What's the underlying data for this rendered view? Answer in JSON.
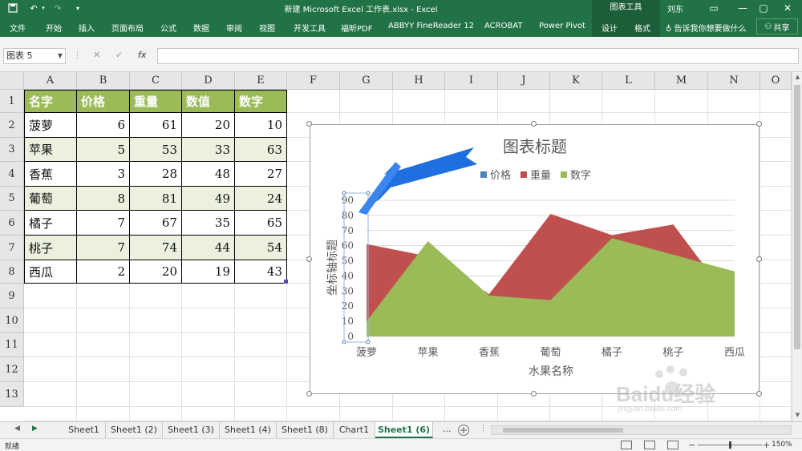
{
  "titlebar": {
    "undo_icon": "undo-icon",
    "redo_icon": "redo-icon",
    "document_title": "新建 Microsoft Excel 工作表.xlsx - Excel",
    "context_tools_label": "图表工具",
    "user_name": "刘东"
  },
  "ribbon": {
    "tabs": [
      "文件",
      "开始",
      "插入",
      "页面布局",
      "公式",
      "数据",
      "审阅",
      "视图",
      "开发工具",
      "福昕PDF",
      "ABBYY FineReader 12",
      "ACROBAT",
      "Power Pivot",
      "设计",
      "格式"
    ],
    "tell_me": "告诉我你想要做什么",
    "share_label": "共享"
  },
  "formula_bar": {
    "name_box": "图表 5",
    "fx_label": "fx",
    "formula_value": ""
  },
  "sheet": {
    "columns": [
      "A",
      "B",
      "C",
      "D",
      "E",
      "F",
      "G",
      "H",
      "I",
      "J",
      "K",
      "L",
      "M",
      "N",
      "O"
    ],
    "rows": [
      "1",
      "2",
      "3",
      "4",
      "5",
      "6",
      "7",
      "8",
      "9",
      "10",
      "11",
      "12",
      "13"
    ],
    "table": {
      "headers": [
        "名字",
        "价格",
        "重量",
        "数值",
        "数字"
      ],
      "rows": [
        [
          "菠萝",
          "6",
          "61",
          "20",
          "10"
        ],
        [
          "苹果",
          "5",
          "53",
          "33",
          "63"
        ],
        [
          "香蕉",
          "3",
          "28",
          "48",
          "27"
        ],
        [
          "葡萄",
          "8",
          "81",
          "49",
          "24"
        ],
        [
          "橘子",
          "7",
          "67",
          "35",
          "65"
        ],
        [
          "桃子",
          "7",
          "74",
          "44",
          "54"
        ],
        [
          "西瓜",
          "2",
          "20",
          "19",
          "43"
        ]
      ]
    }
  },
  "chart_data": {
    "type": "area",
    "title": "图表标题",
    "xlabel": "水果名称",
    "ylabel": "坐标轴标题",
    "categories": [
      "菠萝",
      "苹果",
      "香蕉",
      "葡萄",
      "橘子",
      "桃子",
      "西瓜"
    ],
    "series": [
      {
        "name": "价格",
        "values": [
          6,
          5,
          3,
          8,
          7,
          7,
          2
        ],
        "color": "#4f81bd"
      },
      {
        "name": "重量",
        "values": [
          61,
          53,
          28,
          81,
          67,
          74,
          20
        ],
        "color": "#c0504d"
      },
      {
        "name": "数字",
        "values": [
          10,
          63,
          27,
          24,
          65,
          54,
          43
        ],
        "color": "#9bbb59"
      }
    ],
    "ylim": [
      0,
      90
    ],
    "yticks": [
      "0",
      "10",
      "20",
      "30",
      "40",
      "50",
      "60",
      "70",
      "80",
      "90"
    ],
    "grid": true,
    "legend": "top"
  },
  "sheet_tabs": {
    "tabs": [
      "Sheet1",
      "Sheet1 (2)",
      "Sheet1 (3)",
      "Sheet1 (4)",
      "Sheet1 (8)",
      "Chart1",
      "Sheet1 (6)"
    ],
    "active": "Sheet1 (6)",
    "more_label": "..."
  },
  "status_bar": {
    "ready": "就绪",
    "zoom": "150%"
  },
  "watermark": {
    "brand": "Baidu经验",
    "url": "jingyan.baidu.com"
  }
}
